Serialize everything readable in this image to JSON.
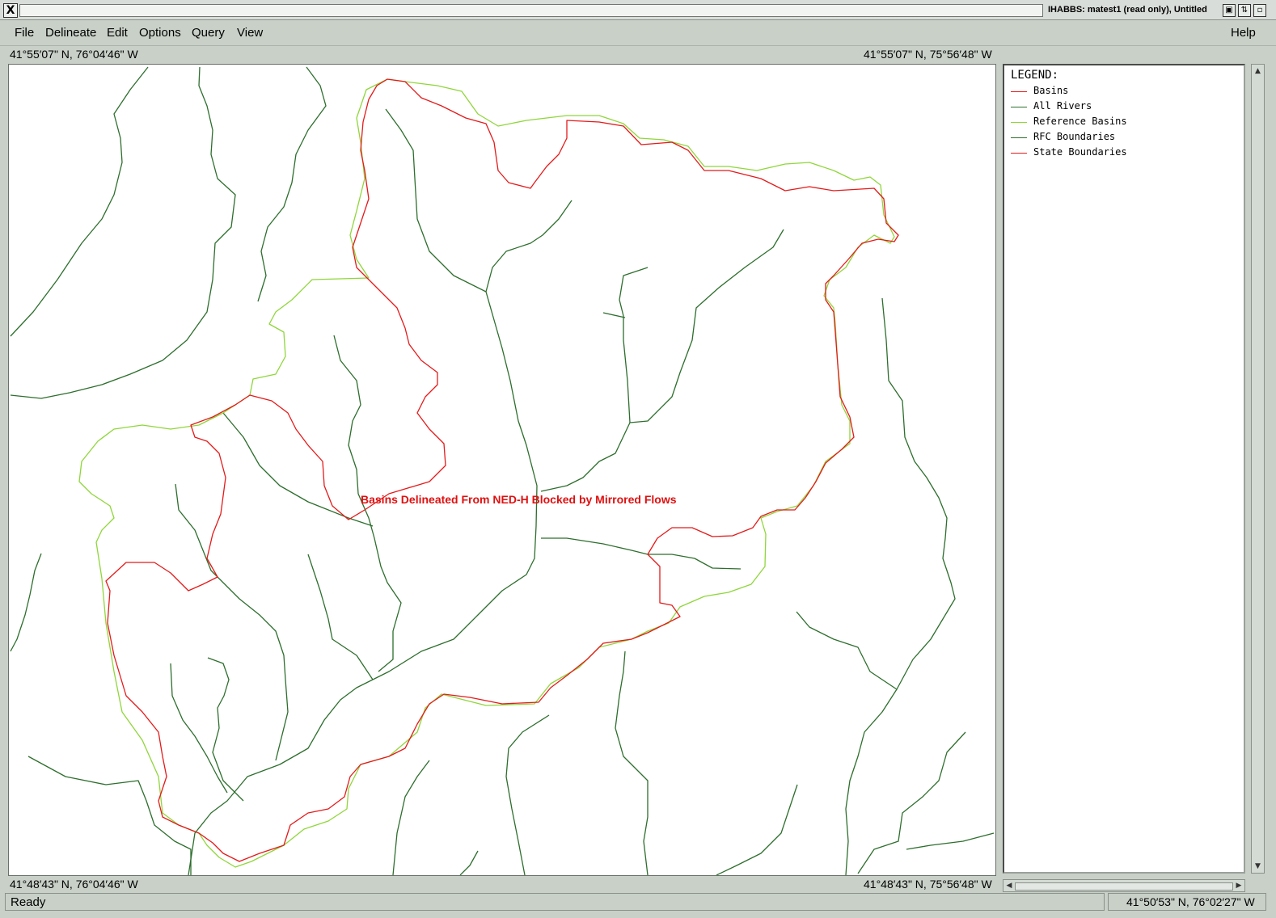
{
  "window": {
    "title": "IHABBS:  matest1 (read only),  Untitled",
    "close_glyph": "X"
  },
  "menu": {
    "items": [
      "File",
      "Delineate",
      "Edit",
      "Options",
      "Query",
      "View"
    ],
    "help": "Help"
  },
  "coords": {
    "top_left": "41°55′07\" N, 76°04′46\" W",
    "top_right": "41°55′07\" N, 75°56′48\" W",
    "bottom_left": "41°48′43\" N, 76°04′46\" W",
    "bottom_right": "41°48′43\" N, 75°56′48\" W"
  },
  "map": {
    "label": "Basins Delineated From NED-H Blocked by Mirrored Flows",
    "colors": {
      "basins": "#e41a1a",
      "rivers": "#2d6e2d",
      "reference": "#8fd63a"
    }
  },
  "legend": {
    "title": "LEGEND:",
    "items": [
      {
        "label": "Basins",
        "color": "#e41a1a"
      },
      {
        "label": "All Rivers",
        "color": "#2d6e2d"
      },
      {
        "label": "Reference Basins",
        "color": "#8fd63a"
      },
      {
        "label": "RFC Boundaries",
        "color": "#2d6e2d"
      },
      {
        "label": "State Boundaries",
        "color": "#e41a1a"
      }
    ]
  },
  "status": {
    "text": "Ready",
    "cursor_coord": "41°50′53\" N, 76°02′27\" W"
  }
}
